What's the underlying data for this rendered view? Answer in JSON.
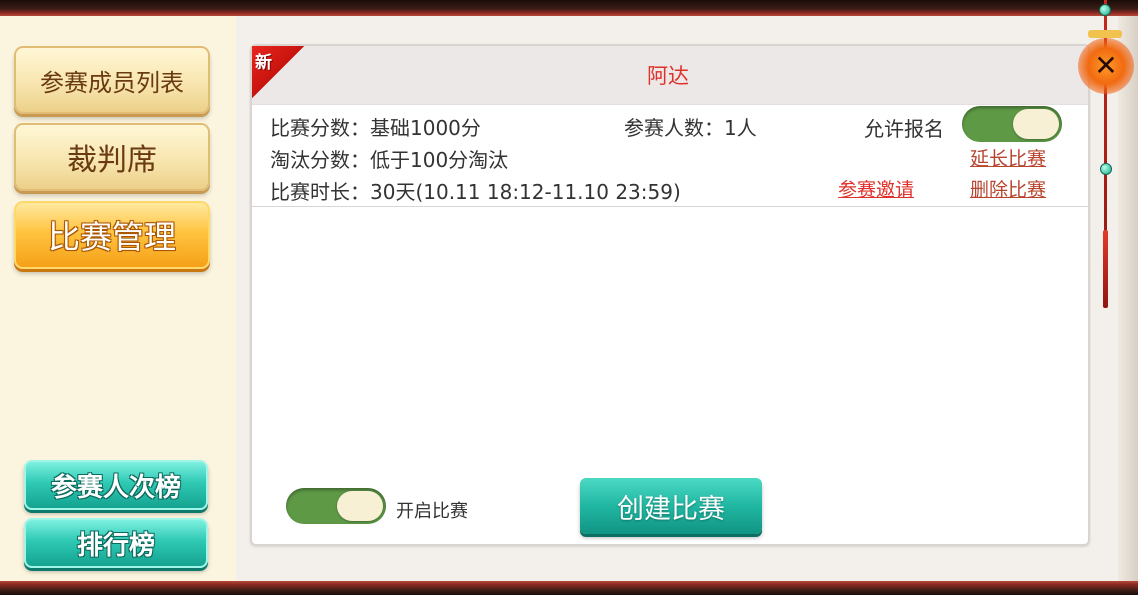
{
  "sidebar": {
    "members_list_label": "参赛成员列表",
    "referee_label": "裁判席",
    "match_manage_label": "比赛管理",
    "participation_rank_label": "参赛人次榜",
    "leaderboard_label": "排行榜"
  },
  "match": {
    "new_badge": "新",
    "name": "阿达",
    "score_label": "比赛分数：基础1000分",
    "participants_label": "参赛人数：1人",
    "allow_signup_label": "允许报名",
    "allow_signup_enabled": true,
    "elimination_label": "淘汰分数：低于100分淘汰",
    "duration_label": "比赛时长：30天(10.11 18:12-11.10 23:59)",
    "invite_link": "参赛邀请",
    "extend_link": "延长比赛",
    "delete_link": "删除比赛"
  },
  "footer": {
    "open_match_label": "开启比赛",
    "open_match_enabled": true,
    "create_match_label": "创建比赛"
  },
  "close_icon": "close-icon",
  "colors": {
    "accent_red": "#e0302a",
    "link_dark_red": "#b8442e",
    "toggle_green": "#5e9a46",
    "teal_button": "#20b7a2",
    "active_tab_orange": "#ffc440"
  }
}
